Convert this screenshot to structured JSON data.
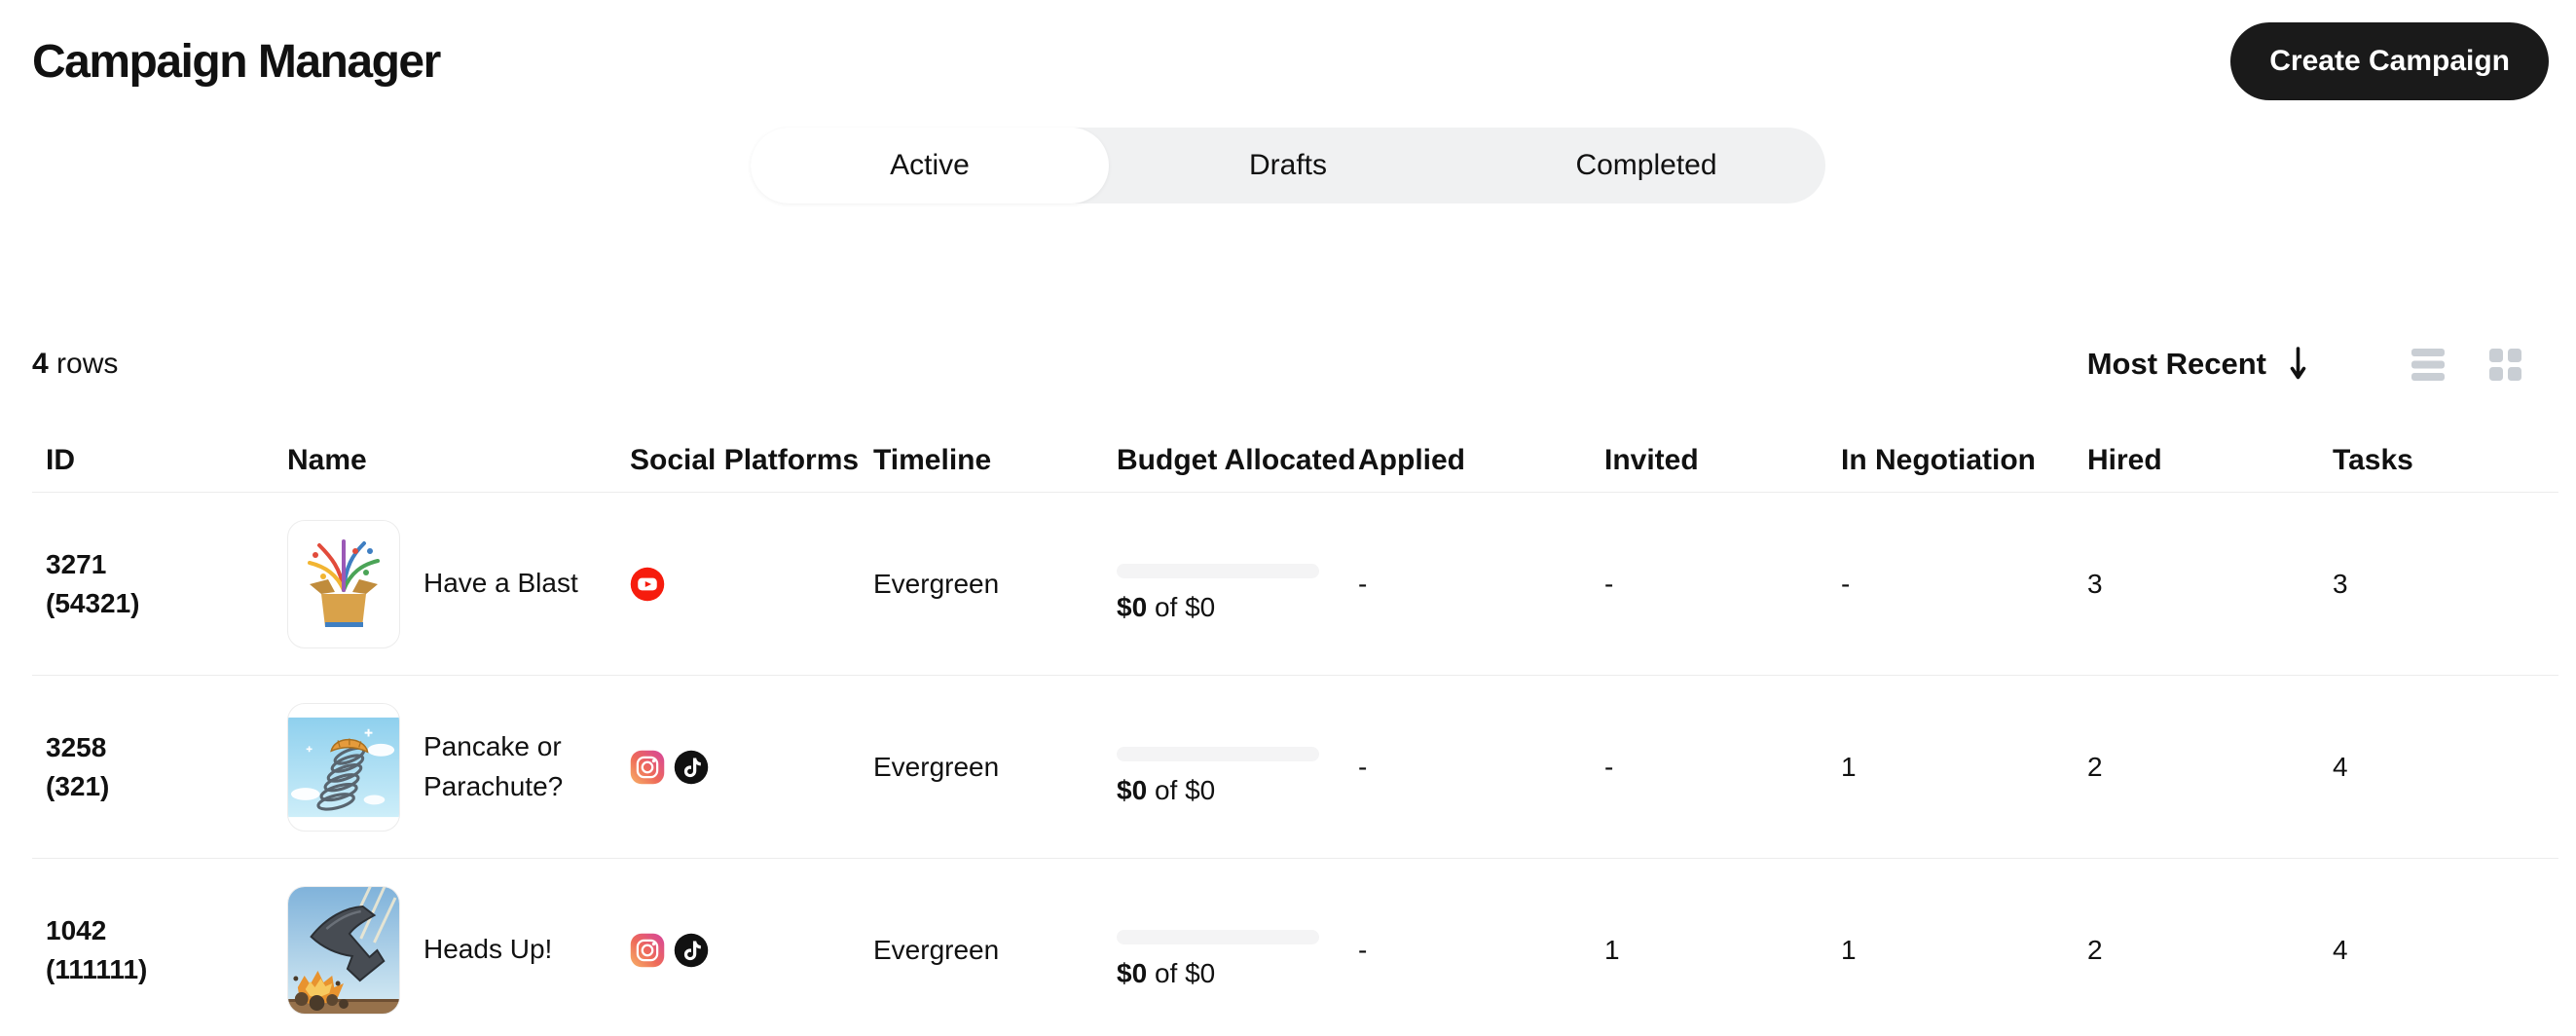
{
  "header": {
    "title": "Campaign Manager",
    "create_button_label": "Create Campaign"
  },
  "tabs": [
    {
      "label": "Active",
      "active": true
    },
    {
      "label": "Drafts",
      "active": false
    },
    {
      "label": "Completed",
      "active": false
    }
  ],
  "controls": {
    "rows_count": "4",
    "rows_label": "rows",
    "sort_label": "Most Recent",
    "sort_direction": "descending"
  },
  "icons": {
    "sort_arrow": "arrow-down-icon",
    "view_list": "list-view-icon",
    "view_grid": "grid-view-icon",
    "platforms": {
      "youtube": "youtube-icon",
      "instagram": "instagram-icon",
      "tiktok": "tiktok-icon"
    }
  },
  "table": {
    "columns": [
      "ID",
      "Name",
      "Social Platforms",
      "Timeline",
      "Budget Allocated",
      "Applied",
      "Invited",
      "In Negotiation",
      "Hired",
      "Tasks"
    ],
    "rows": [
      {
        "id": "3271",
        "sub_id": "(54321)",
        "name": "Have a Blast",
        "thumbnail_icon": "confetti-box",
        "social_platforms": [
          "youtube"
        ],
        "timeline": "Evergreen",
        "budget_spent": "$0",
        "budget_of": "of",
        "budget_total": "$0",
        "applied": "-",
        "invited": "-",
        "in_negotiation": "-",
        "hired": "3",
        "tasks": "3"
      },
      {
        "id": "3258",
        "sub_id": "(321)",
        "name": "Pancake or Parachute?",
        "thumbnail_icon": "slinky-pancake",
        "social_platforms": [
          "instagram",
          "tiktok"
        ],
        "timeline": "Evergreen",
        "budget_spent": "$0",
        "budget_of": "of",
        "budget_total": "$0",
        "applied": "-",
        "invited": "-",
        "in_negotiation": "1",
        "hired": "2",
        "tasks": "4"
      },
      {
        "id": "1042",
        "sub_id": "(111111)",
        "name": "Heads Up!",
        "thumbnail_icon": "anvil-crash",
        "social_platforms": [
          "instagram",
          "tiktok"
        ],
        "timeline": "Evergreen",
        "budget_spent": "$0",
        "budget_of": "of",
        "budget_total": "$0",
        "applied": "-",
        "invited": "1",
        "in_negotiation": "1",
        "hired": "2",
        "tasks": "4"
      }
    ]
  },
  "colors": {
    "text": "#111111",
    "button_bg": "#1a1a1a",
    "button_text": "#ffffff",
    "tab_bar_bg": "#f0f1f2",
    "tab_active_bg": "#ffffff",
    "divider": "#ececec",
    "muted_icon": "#c9ced4",
    "progress_bg": "#f4f4f5",
    "youtube_red": "#f61c0d",
    "tiktok_black": "#111111"
  }
}
